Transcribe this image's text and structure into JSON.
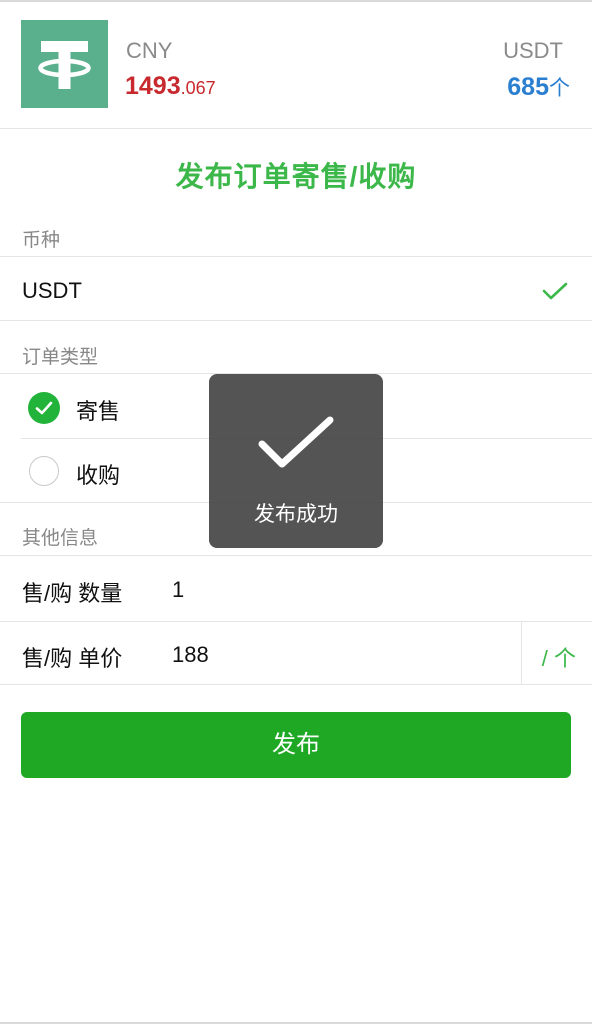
{
  "header": {
    "logo_icon": "tether-logo-icon",
    "cny_label": "CNY",
    "cny_int": "1493",
    "cny_dec": ".067",
    "usdt_label": "USDT",
    "usdt_value": "685",
    "usdt_unit": "个"
  },
  "title": "发布订单寄售/收购",
  "currency": {
    "section_label": "币种",
    "selected": "USDT",
    "selected_icon": "checkmark-icon"
  },
  "order_type": {
    "section_label": "订单类型",
    "options": [
      {
        "label": "寄售",
        "checked": true
      },
      {
        "label": "收购",
        "checked": false
      }
    ]
  },
  "other_info": {
    "section_label": "其他信息",
    "quantity_label": "售/购 数量",
    "quantity_value": "1",
    "price_label": "售/购 单价",
    "price_value": "188",
    "price_unit": "/ 个"
  },
  "publish_button": "发布",
  "toast": {
    "icon": "checkmark-icon",
    "message": "发布成功"
  },
  "colors": {
    "accent_green": "#3cb84a",
    "button_green": "#1ea824",
    "cny_red": "#c8292e",
    "usdt_blue": "#2a7fd0",
    "logo_green": "#5aaf8c"
  }
}
